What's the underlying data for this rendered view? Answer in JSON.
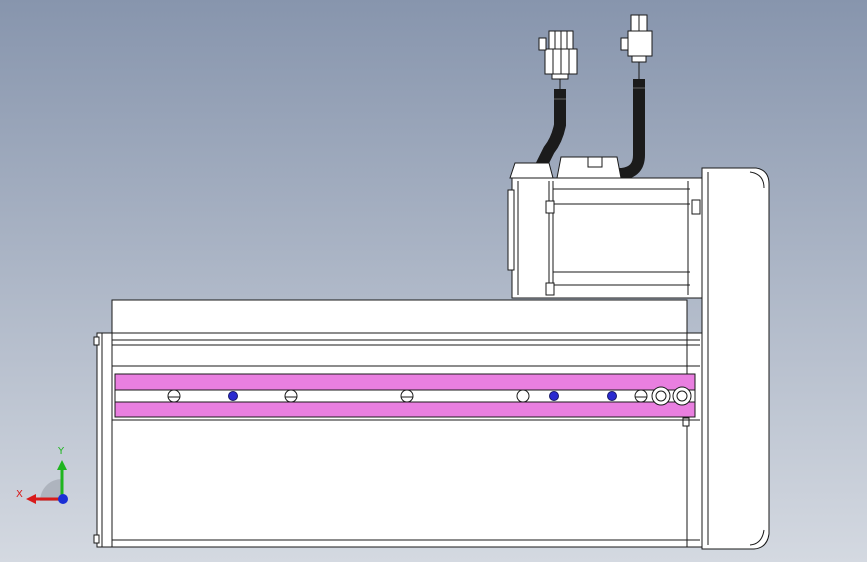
{
  "viewport": {
    "background_top": "#8795ad",
    "background_bottom": "#d4d9e1",
    "line_color": "#1a1a1a",
    "body_fill": "#ffffff",
    "slot_color": "#e97fe0",
    "marker_color": "#2a2ad0",
    "cable_color": "#1b1b1b"
  },
  "triad": {
    "x_label": "X",
    "y_label": "Y",
    "x_color": "#d81b1b",
    "y_color": "#1fb51f",
    "z_color": "#1a2fd6"
  },
  "parts": {
    "actuator_body": "linear-actuator-body",
    "motor": "servo-motor",
    "end_plate": "motor-end-plate",
    "encoder_connector": "encoder-connector",
    "power_connector": "power-connector"
  }
}
